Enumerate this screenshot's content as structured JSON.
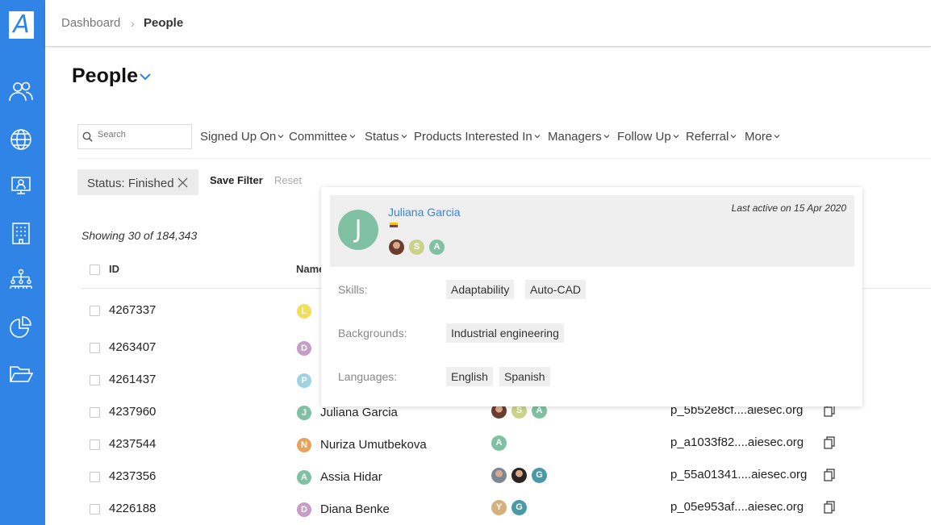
{
  "app": {
    "logo_letter": "A",
    "accent": "#2f84e6"
  },
  "sidebar": {
    "items": [
      "people-icon",
      "globe-icon",
      "monitor-user-icon",
      "building-icon",
      "org-chart-icon",
      "pie-chart-icon",
      "folder-open-icon"
    ]
  },
  "breadcrumb": {
    "home": "Dashboard",
    "separator": "›",
    "current": "People"
  },
  "page": {
    "title": "People"
  },
  "search": {
    "placeholder": "Search",
    "value": ""
  },
  "filters": [
    "Signed Up On",
    "Committee",
    "Status",
    "Products Interested In",
    "Managers",
    "Follow Up",
    "Referral",
    "More"
  ],
  "active_filter": {
    "label": "Status: Finished"
  },
  "actions": {
    "save_filter": "Save Filter",
    "reset": "Reset"
  },
  "results": {
    "showing": "Showing 30 of 184,343"
  },
  "table": {
    "columns": {
      "id": "ID",
      "name": "Name"
    },
    "rows": [
      {
        "id": "4267337",
        "initial": "L",
        "color": "#f1dd5e",
        "name": "",
        "managers": [],
        "email": ""
      },
      {
        "id": "4263407",
        "initial": "D",
        "color": "#c79cc8",
        "name": "",
        "managers": [],
        "email": ""
      },
      {
        "id": "4261437",
        "initial": "P",
        "color": "#9fd3e3",
        "name": "",
        "managers": [],
        "email": ""
      },
      {
        "id": "4237960",
        "initial": "J",
        "color": "#7fc1a2",
        "name": "Juliana Garcia",
        "managers": [
          {
            "t": "photo",
            "c": "#6b3d2f"
          },
          {
            "t": "S",
            "c": "#c9d38a"
          },
          {
            "t": "A",
            "c": "#7fc1a2"
          }
        ],
        "email": "p_5b52e8cf....aiesec.org"
      },
      {
        "id": "4237544",
        "initial": "N",
        "color": "#e9a25a",
        "name": "Nuriza Umutbekova",
        "managers": [
          {
            "t": "A",
            "c": "#7fc1a2"
          }
        ],
        "email": "p_a1033f82....aiesec.org"
      },
      {
        "id": "4237356",
        "initial": "A",
        "color": "#7fc1a2",
        "name": "Assia Hidar",
        "managers": [
          {
            "t": "photo",
            "c": "#7a8794"
          },
          {
            "t": "photo",
            "c": "#2a2522"
          },
          {
            "t": "G",
            "c": "#4a9aa5"
          }
        ],
        "email": "p_55a01341....aiesec.org"
      },
      {
        "id": "4226188",
        "initial": "D",
        "color": "#c79cc8",
        "name": "Diana Benke",
        "managers": [
          {
            "t": "Y",
            "c": "#d4b07a"
          },
          {
            "t": "G",
            "c": "#4a9aa5"
          }
        ],
        "email": "p_05e953af....aiesec.org"
      }
    ]
  },
  "popup": {
    "initial": "J",
    "name": "Juliana Garcia",
    "last_active": "Last active on 15 Apr 2020",
    "managers": [
      {
        "t": "photo",
        "c": "#6b3d2f"
      },
      {
        "t": "S",
        "c": "#c9d38a"
      },
      {
        "t": "A",
        "c": "#7fc1a2"
      }
    ],
    "skills_label": "Skills:",
    "skills": [
      "Adaptability",
      "Auto-CAD"
    ],
    "backgrounds_label": "Backgrounds:",
    "backgrounds": [
      "Industrial engineering"
    ],
    "languages_label": "Languages:",
    "languages": [
      "English",
      "Spanish"
    ]
  }
}
